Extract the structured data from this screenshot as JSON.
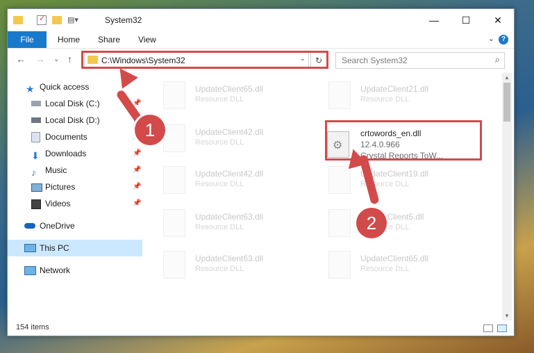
{
  "window": {
    "title": "System32",
    "controls": {
      "minimize": "—",
      "maximize": "☐",
      "close": "✕"
    }
  },
  "ribbon": {
    "tabs": [
      {
        "label": "File"
      },
      {
        "label": "Home"
      },
      {
        "label": "Share"
      },
      {
        "label": "View"
      }
    ],
    "help": "?"
  },
  "navigation": {
    "address": "C:\\Windows\\System32",
    "search_placeholder": "Search System32"
  },
  "sidebar": {
    "items": [
      {
        "label": "Quick access",
        "icon": "star-icon"
      },
      {
        "label": "Local Disk (C:)",
        "icon": "drive-icon",
        "pinned": true
      },
      {
        "label": "Local Disk (D:)",
        "icon": "drive-icon",
        "pinned": true
      },
      {
        "label": "Documents",
        "icon": "documents-icon",
        "pinned": true
      },
      {
        "label": "Downloads",
        "icon": "download-icon",
        "pinned": true
      },
      {
        "label": "Music",
        "icon": "music-icon",
        "pinned": true
      },
      {
        "label": "Pictures",
        "icon": "pictures-icon",
        "pinned": true
      },
      {
        "label": "Videos",
        "icon": "videos-icon",
        "pinned": true
      },
      {
        "label": "OneDrive",
        "icon": "cloud-icon"
      },
      {
        "label": "This PC",
        "icon": "computer-icon",
        "selected": true
      },
      {
        "label": "Network",
        "icon": "network-icon"
      }
    ]
  },
  "files": {
    "background_items": [
      {
        "name": "UpdateClient65.dll",
        "type": "Resource DLL"
      },
      {
        "name": "UpdateClient21.dll",
        "type": "Resource DLL"
      },
      {
        "name": "UpdateClient42.dll",
        "type": "Resource DLL"
      },
      {
        "name": "UpdateClient42.dll",
        "type": "Resource DLL"
      },
      {
        "name": "UpdateClient19.dll",
        "type": "Resource DLL"
      },
      {
        "name": "UpdateClient63.dll",
        "type": "Resource DLL"
      },
      {
        "name": "UpdateClient5.dll",
        "type": "Resource DLL"
      },
      {
        "name": "UpdateClient63.dll",
        "type": "Resource DLL"
      },
      {
        "name": "UpdateClient65.dll",
        "type": "Resource DLL"
      }
    ],
    "featured": {
      "name": "crtowords_en.dll",
      "version": "12.4.0.966",
      "description": "Crystal Reports ToW..."
    }
  },
  "status": {
    "item_count": "154 items"
  },
  "annotations": {
    "step1": "1",
    "step2": "2",
    "color": "#d34a4a"
  }
}
